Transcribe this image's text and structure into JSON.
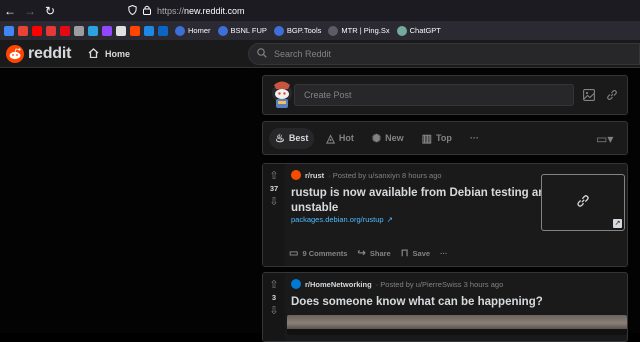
{
  "browser": {
    "url_proto": "https://",
    "url_host": "new.reddit.com"
  },
  "bookmarks": [
    {
      "icon": "google-icon",
      "color": "#4285f4"
    },
    {
      "icon": "gmail-icon",
      "color": "#ea4335"
    },
    {
      "icon": "youtube-icon",
      "color": "#ff0000"
    },
    {
      "icon": "red-square-icon",
      "color": "#e53935"
    },
    {
      "icon": "netflix-icon",
      "color": "#e50914"
    },
    {
      "icon": "grid-icon",
      "color": "#9e9e9e"
    },
    {
      "icon": "telegram-icon",
      "color": "#2aa3e0"
    },
    {
      "icon": "twitch-icon",
      "color": "#9146ff"
    },
    {
      "icon": "x-icon",
      "color": "#e0e0e0"
    },
    {
      "icon": "reddit-icon",
      "color": "#ff4500"
    },
    {
      "icon": "edge-icon",
      "color": "#1e88e5"
    },
    {
      "icon": "linkedin-icon",
      "color": "#0a66c2"
    }
  ],
  "bookmark_labels": [
    {
      "icon": "globe-icon",
      "label": "Homer"
    },
    {
      "icon": "globe-icon",
      "label": "BSNL FUP"
    },
    {
      "icon": "globe-icon",
      "label": "BGP.Tools"
    },
    {
      "icon": "mtr-icon",
      "label": "MTR | Ping.Sx"
    },
    {
      "icon": "chatgpt-icon",
      "label": "ChatGPT"
    }
  ],
  "header": {
    "brand": "reddit",
    "home_label": "Home",
    "search_placeholder": "Search Reddit"
  },
  "create_post": {
    "placeholder": "Create Post"
  },
  "sort": {
    "items": [
      {
        "label": "Best",
        "icon": "rocket-icon",
        "active": true
      },
      {
        "label": "Hot",
        "icon": "flame-icon",
        "active": false
      },
      {
        "label": "New",
        "icon": "sparkle-icon",
        "active": false
      },
      {
        "label": "Top",
        "icon": "bar-chart-icon",
        "active": false
      }
    ],
    "more": "···"
  },
  "posts": [
    {
      "score": "37",
      "subreddit": "r/rust",
      "posted_by": "· Posted by u/sanxiyn 8 hours ago",
      "title_line1": "rustup is now available from Debian testing and",
      "title_line2": "unstable",
      "link": "packages.debian.org/rustup",
      "comments": "9 Comments",
      "share": "Share",
      "save": "Save",
      "more": "···"
    },
    {
      "score": "3",
      "subreddit": "r/HomeNetworking",
      "posted_by": "· Posted by u/PierreSwiss 3 hours ago",
      "title_line1": "Does someone know what can be happening?"
    }
  ],
  "colors": {
    "brand": "#ff4500",
    "link": "#4fbcff",
    "card": "#1a1a1b"
  }
}
